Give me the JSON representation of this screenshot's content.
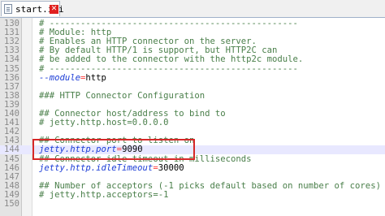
{
  "tab": {
    "label": "start.ini",
    "close": "✕",
    "icon": "file-icon"
  },
  "colors": {
    "comment": "#4a7f4a",
    "key": "#1b3cd6",
    "operator": "#ff3c3c",
    "highlight_box": "#d62828",
    "current_line": "#e8e8ff"
  },
  "lines": [
    {
      "num": "130",
      "segments": [
        {
          "text": "# ------------------------------------------------",
          "cls": "comment"
        }
      ]
    },
    {
      "num": "131",
      "segments": [
        {
          "text": "# Module: http",
          "cls": "comment"
        }
      ]
    },
    {
      "num": "132",
      "segments": [
        {
          "text": "# Enables an HTTP connector on the server.",
          "cls": "comment"
        }
      ]
    },
    {
      "num": "133",
      "segments": [
        {
          "text": "# By default HTTP/1 is support, but HTTP2C can",
          "cls": "comment"
        }
      ]
    },
    {
      "num": "134",
      "segments": [
        {
          "text": "# be added to the connector with the http2c module.",
          "cls": "comment"
        }
      ]
    },
    {
      "num": "135",
      "segments": [
        {
          "text": "# ------------------------------------------------",
          "cls": "comment"
        }
      ]
    },
    {
      "num": "136",
      "segments": [
        {
          "text": "--module",
          "cls": "key italic"
        },
        {
          "text": "=",
          "cls": "op"
        },
        {
          "text": "http",
          "cls": "val"
        }
      ]
    },
    {
      "num": "137",
      "segments": []
    },
    {
      "num": "138",
      "segments": [
        {
          "text": "### HTTP Connector Configuration",
          "cls": "comment"
        }
      ]
    },
    {
      "num": "139",
      "segments": []
    },
    {
      "num": "140",
      "segments": [
        {
          "text": "## Connector host/address to bind to",
          "cls": "comment"
        }
      ]
    },
    {
      "num": "141",
      "segments": [
        {
          "text": "# jetty.http.host=0.0.0.0",
          "cls": "comment"
        }
      ]
    },
    {
      "num": "142",
      "segments": []
    },
    {
      "num": "143",
      "segments": [
        {
          "text": "## Connector port to listen on",
          "cls": "comment"
        }
      ]
    },
    {
      "num": "144",
      "current": true,
      "segments": [
        {
          "text": "jetty.http.port",
          "cls": "key italic"
        },
        {
          "text": "=",
          "cls": "op"
        },
        {
          "text": "9090",
          "cls": "val"
        }
      ]
    },
    {
      "num": "145",
      "segments": [
        {
          "text": "## Connector idle timeout in milliseconds",
          "cls": "comment"
        }
      ]
    },
    {
      "num": "146",
      "segments": [
        {
          "text": "jetty.http.idleTimeout",
          "cls": "key italic"
        },
        {
          "text": "=",
          "cls": "op"
        },
        {
          "text": "30000",
          "cls": "val"
        }
      ]
    },
    {
      "num": "147",
      "segments": []
    },
    {
      "num": "148",
      "segments": [
        {
          "text": "## Number of acceptors (-1 picks default based on number of cores)",
          "cls": "comment"
        }
      ]
    },
    {
      "num": "149",
      "segments": [
        {
          "text": "# jetty.http.acceptors=-1",
          "cls": "comment"
        }
      ]
    },
    {
      "num": "150",
      "segments": []
    }
  ]
}
